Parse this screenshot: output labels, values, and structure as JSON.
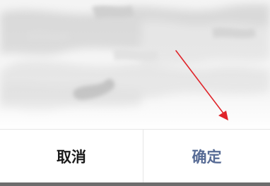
{
  "dialog": {
    "cancel_label": "取消",
    "confirm_label": "确定"
  },
  "colors": {
    "cancel_text": "#1a1a1a",
    "confirm_text": "#576b95",
    "annotation_arrow": "#e0242a",
    "bottom_bar": "#6d6d6d",
    "divider": "#e6e6e6"
  }
}
